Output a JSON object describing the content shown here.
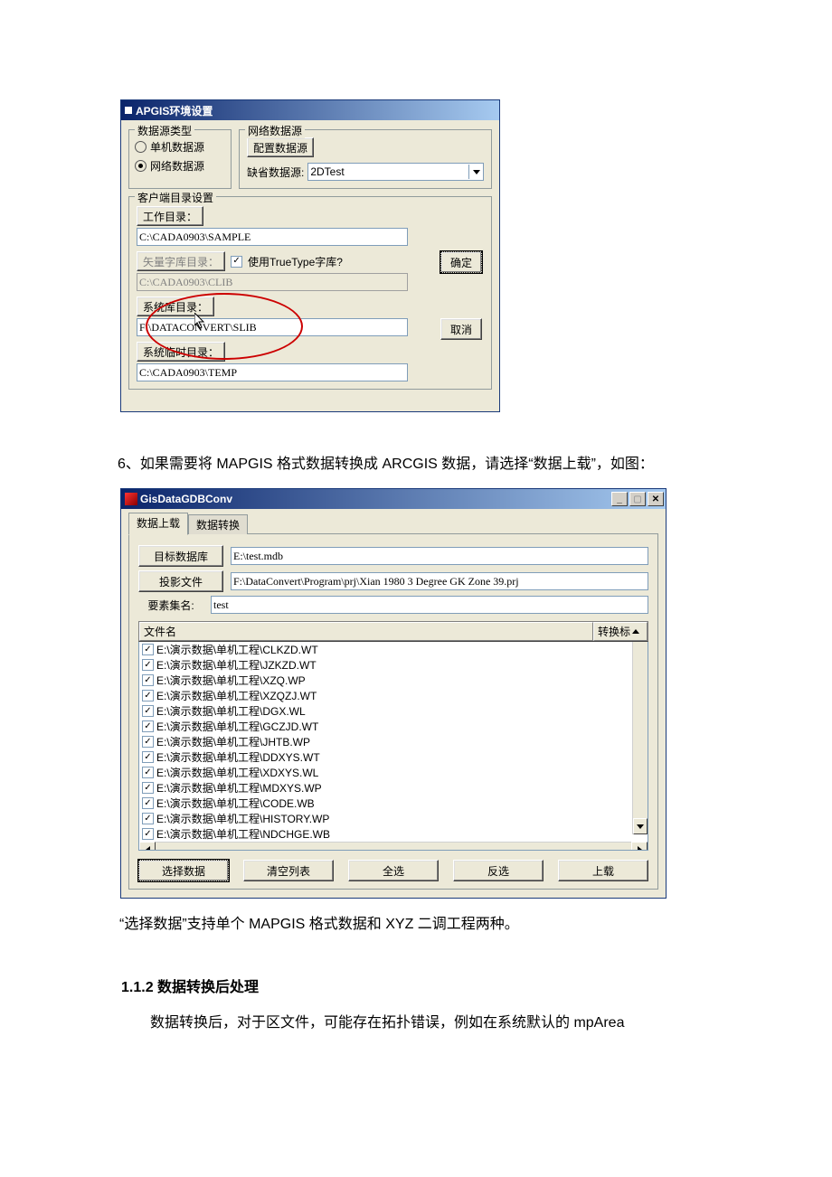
{
  "dlg1": {
    "title": "APGIS环境设置",
    "ds_group": "数据源类型",
    "radio_single": "单机数据源",
    "radio_net": "网络数据源",
    "net_group": "网络数据源",
    "config_btn": "配置数据源",
    "default_lbl": "缺省数据源:",
    "default_val": "2DTest",
    "client_group": "客户端目录设置",
    "workdir_btn": "工作目录：",
    "workdir_val": "C:\\CADA0903\\SAMPLE",
    "vecfont_btn": "矢量字库目录：",
    "use_tt": "使用TrueType字库?",
    "vecfont_val": "C:\\CADA0903\\CLIB",
    "syslib_btn": "系统库目录：",
    "syslib_val": "F:\\DATACONVERT\\SLIB",
    "systmp_btn": "系统临时目录：",
    "systmp_val": "C:\\CADA0903\\TEMP",
    "ok": "确定",
    "cancel": "取消"
  },
  "para6": "6、如果需要将 MAPGIS 格式数据转换成 ARCGIS 数据，请选择“数据上载”，如图：",
  "dlg2": {
    "title": "GisDataGDBConv",
    "tab_upload": "数据上载",
    "tab_convert": "数据转换",
    "targetdb_btn": "目标数据库",
    "targetdb_val": "E:\\test.mdb",
    "proj_btn": "投影文件",
    "proj_val": "F:\\DataConvert\\Program\\prj\\Xian 1980 3 Degree GK Zone 39.prj",
    "fc_lbl": "要素集名:",
    "fc_val": "test",
    "col_filename": "文件名",
    "col_flag": "转换标",
    "files": [
      "E:\\演示数据\\单机工程\\CLKZD.WT",
      "E:\\演示数据\\单机工程\\JZKZD.WT",
      "E:\\演示数据\\单机工程\\XZQ.WP",
      "E:\\演示数据\\单机工程\\XZQZJ.WT",
      "E:\\演示数据\\单机工程\\DGX.WL",
      "E:\\演示数据\\单机工程\\GCZJD.WT",
      "E:\\演示数据\\单机工程\\JHTB.WP",
      "E:\\演示数据\\单机工程\\DDXYS.WT",
      "E:\\演示数据\\单机工程\\XDXYS.WL",
      "E:\\演示数据\\单机工程\\MDXYS.WP",
      "E:\\演示数据\\单机工程\\CODE.WB",
      "E:\\演示数据\\单机工程\\HISTORY.WP",
      "E:\\演示数据\\单机工程\\NDCHGE.WB"
    ],
    "select_btn": "选择数据",
    "clear_btn": "清空列表",
    "all_btn": "全选",
    "inv_btn": "反选",
    "upload_btn": "上载"
  },
  "note": "“选择数据”支持单个 MAPGIS 格式数据和 XYZ 二调工程两种。",
  "h112": "1.1.2  数据转换后处理",
  "body112": "数据转换后，对于区文件，可能存在拓扑错误，例如在系统默认的 mpArea"
}
